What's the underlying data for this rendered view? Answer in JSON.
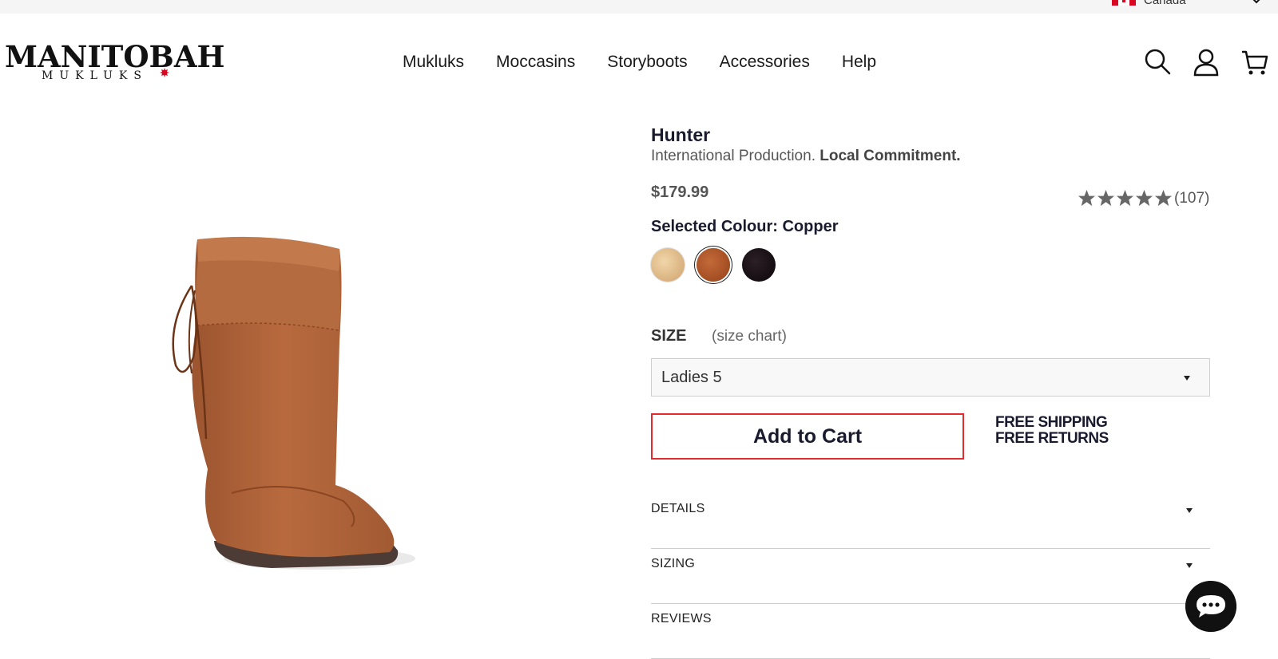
{
  "top_bar": {
    "country_label": "Canada",
    "country_flag_icon": "canada-flag-icon"
  },
  "brand": {
    "name": "MANITOBAH",
    "sub": "MUKLUKS"
  },
  "nav": {
    "items": [
      "Mukluks",
      "Moccasins",
      "Storyboots",
      "Accessories",
      "Help"
    ]
  },
  "header_icons": [
    "search-icon",
    "account-icon",
    "cart-icon"
  ],
  "product": {
    "title": "Hunter",
    "tagline_plain": "International Production. ",
    "tagline_bold": "Local Commitment.",
    "price": "$179.99",
    "rating_stars": 5,
    "rating_count": "(107)",
    "colour_label": "Selected Colour: Copper",
    "colours": [
      "Sand",
      "Copper",
      "Black"
    ],
    "selected_colour": "Copper",
    "colour_hex": [
      "#e3bf8c",
      "#a9532a",
      "#1a1118"
    ],
    "size_label": "SIZE",
    "size_chart_link": "(size chart)",
    "size_selected": "Ladies 5",
    "add_to_cart": "Add to Cart",
    "shipping_line1": "FREE SHIPPING",
    "shipping_line2": "FREE RETURNS"
  },
  "accordions": [
    "DETAILS",
    "SIZING",
    "REVIEWS"
  ],
  "colors": {
    "accent_red": "#e52b2b",
    "text_dark": "#1a1a2e",
    "star_grey": "#666666"
  }
}
